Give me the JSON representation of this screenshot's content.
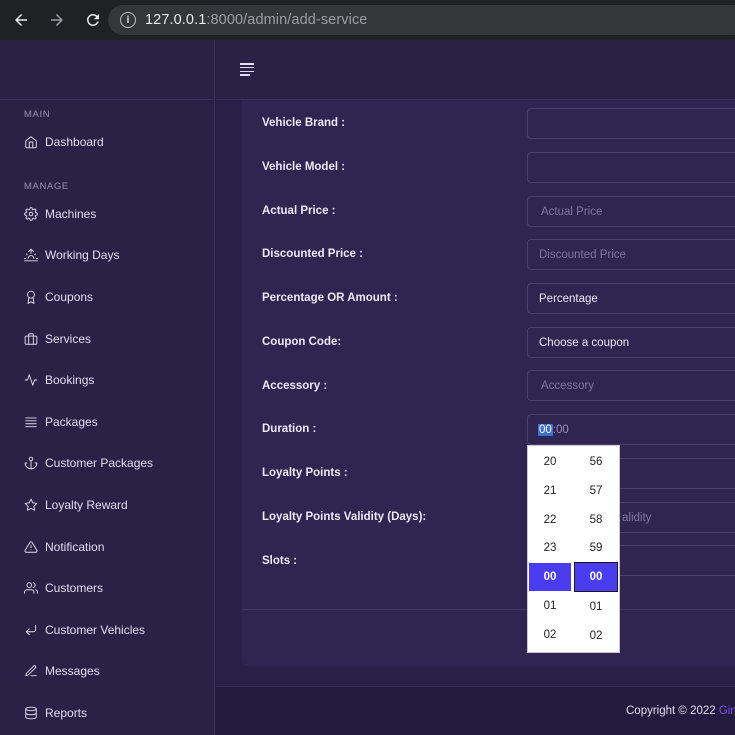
{
  "browser": {
    "url_host": "127.0.0.1",
    "url_rest": ":8000/admin/add-service"
  },
  "sidebar": {
    "sections": {
      "main": "MAIN",
      "manage": "MANAGE"
    },
    "items": [
      {
        "label": "Dashboard",
        "icon": "home-icon"
      },
      {
        "label": "Machines",
        "icon": "gear-icon"
      },
      {
        "label": "Working Days",
        "icon": "sunrise-icon"
      },
      {
        "label": "Coupons",
        "icon": "award-icon"
      },
      {
        "label": "Services",
        "icon": "briefcase-icon"
      },
      {
        "label": "Bookings",
        "icon": "activity-icon"
      },
      {
        "label": "Packages",
        "icon": "list-icon"
      },
      {
        "label": "Customer Packages",
        "icon": "anchor-icon"
      },
      {
        "label": "Loyalty Reward",
        "icon": "star-icon"
      },
      {
        "label": "Notification",
        "icon": "alert-triangle-icon"
      },
      {
        "label": "Customers",
        "icon": "users-icon"
      },
      {
        "label": "Customer Vehicles",
        "icon": "corner-down-left-icon"
      },
      {
        "label": "Messages",
        "icon": "edit-icon"
      },
      {
        "label": "Reports",
        "icon": "database-icon"
      }
    ]
  },
  "form": {
    "vehicle_brand": {
      "label": "Vehicle Brand :",
      "value": ""
    },
    "vehicle_model": {
      "label": "Vehicle Model :",
      "value": ""
    },
    "actual_price": {
      "label": "Actual Price :",
      "placeholder": "Actual Price"
    },
    "discounted_price": {
      "label": "Discounted Price :",
      "placeholder": "Discounted Price"
    },
    "percentage_or_amount": {
      "label": "Percentage OR Amount :",
      "value": "Percentage"
    },
    "coupon_code": {
      "label": "Coupon Code:",
      "value": "Choose a coupon"
    },
    "accessory": {
      "label": "Accessory :",
      "placeholder": "Accessory"
    },
    "duration": {
      "label": "Duration :",
      "hours": "00",
      "rest": ":00"
    },
    "loyalty_points": {
      "label": "Loyalty Points :"
    },
    "loyalty_validity": {
      "label": "Loyalty Points Validity (Days):",
      "placeholder_visible": "alidity"
    },
    "slots": {
      "label": "Slots :"
    }
  },
  "time_picker": {
    "hours": [
      "20",
      "21",
      "22",
      "23",
      "00",
      "01",
      "02"
    ],
    "minutes": [
      "56",
      "57",
      "58",
      "59",
      "00",
      "01",
      "02"
    ],
    "selected_hour": "00",
    "selected_minute": "00"
  },
  "footer": {
    "copyright": "Copyright © 2022 ",
    "brand_visible": "Gin"
  },
  "colors": {
    "accent": "#4a3cf0",
    "brand": "#7b4ff0",
    "background": "#2a1f47"
  }
}
